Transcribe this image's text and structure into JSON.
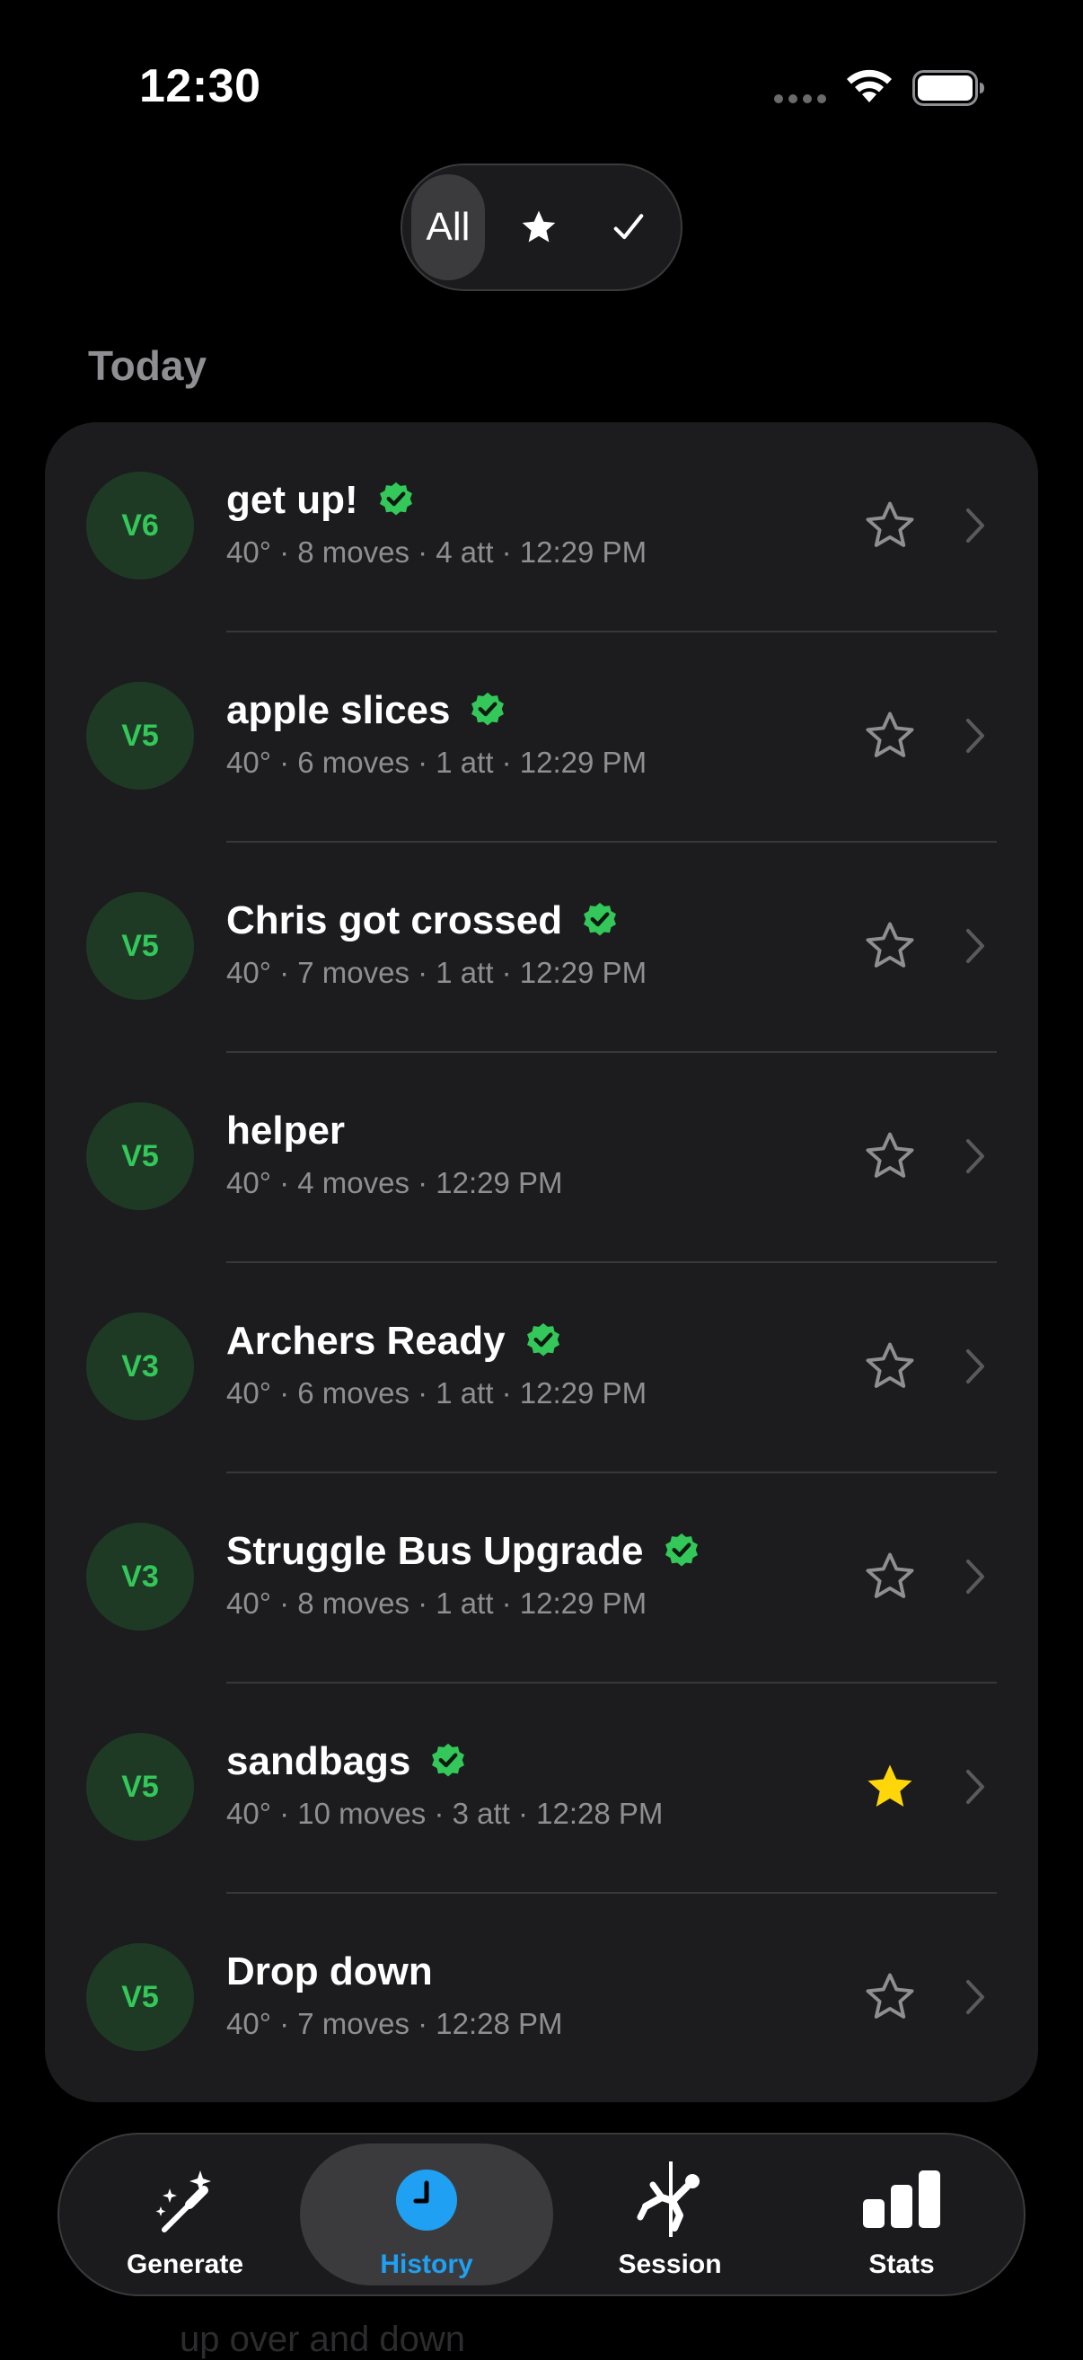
{
  "status_bar": {
    "time": "12:30"
  },
  "filter": {
    "all_label": "All",
    "starred_icon": "star-filled-icon",
    "completed_icon": "checkmark-icon"
  },
  "section": {
    "title": "Today"
  },
  "climbs": [
    {
      "grade": "V6",
      "name": "get up!",
      "meta": "40° · 8 moves · 4 att · 12:29 PM",
      "verified": true,
      "starred": false
    },
    {
      "grade": "V5",
      "name": "apple slices",
      "meta": "40° · 6 moves · 1 att · 12:29 PM",
      "verified": true,
      "starred": false
    },
    {
      "grade": "V5",
      "name": "Chris got crossed",
      "meta": "40° · 7 moves · 1 att · 12:29 PM",
      "verified": true,
      "starred": false
    },
    {
      "grade": "V5",
      "name": "helper",
      "meta": "40° · 4 moves · 12:29 PM",
      "verified": false,
      "starred": false
    },
    {
      "grade": "V3",
      "name": "Archers Ready",
      "meta": "40° · 6 moves · 1 att · 12:29 PM",
      "verified": true,
      "starred": false
    },
    {
      "grade": "V3",
      "name": "Struggle Bus Upgrade",
      "meta": "40° · 8 moves · 1 att · 12:29 PM",
      "verified": true,
      "starred": false
    },
    {
      "grade": "V5",
      "name": "sandbags",
      "meta": "40° · 10 moves · 3 att · 12:28 PM",
      "verified": true,
      "starred": true
    },
    {
      "grade": "V5",
      "name": "Drop down",
      "meta": "40° · 7 moves · 12:28 PM",
      "verified": false,
      "starred": false
    }
  ],
  "tab_bar": {
    "generate": "Generate",
    "history": "History",
    "session": "Session",
    "stats": "Stats"
  },
  "peek": {
    "text": "up over and down"
  },
  "colors": {
    "accent_blue": "#1fa0f2",
    "grade_green": "#34c759",
    "star_gold": "#ffd60a",
    "card_bg": "#1c1c1e"
  }
}
